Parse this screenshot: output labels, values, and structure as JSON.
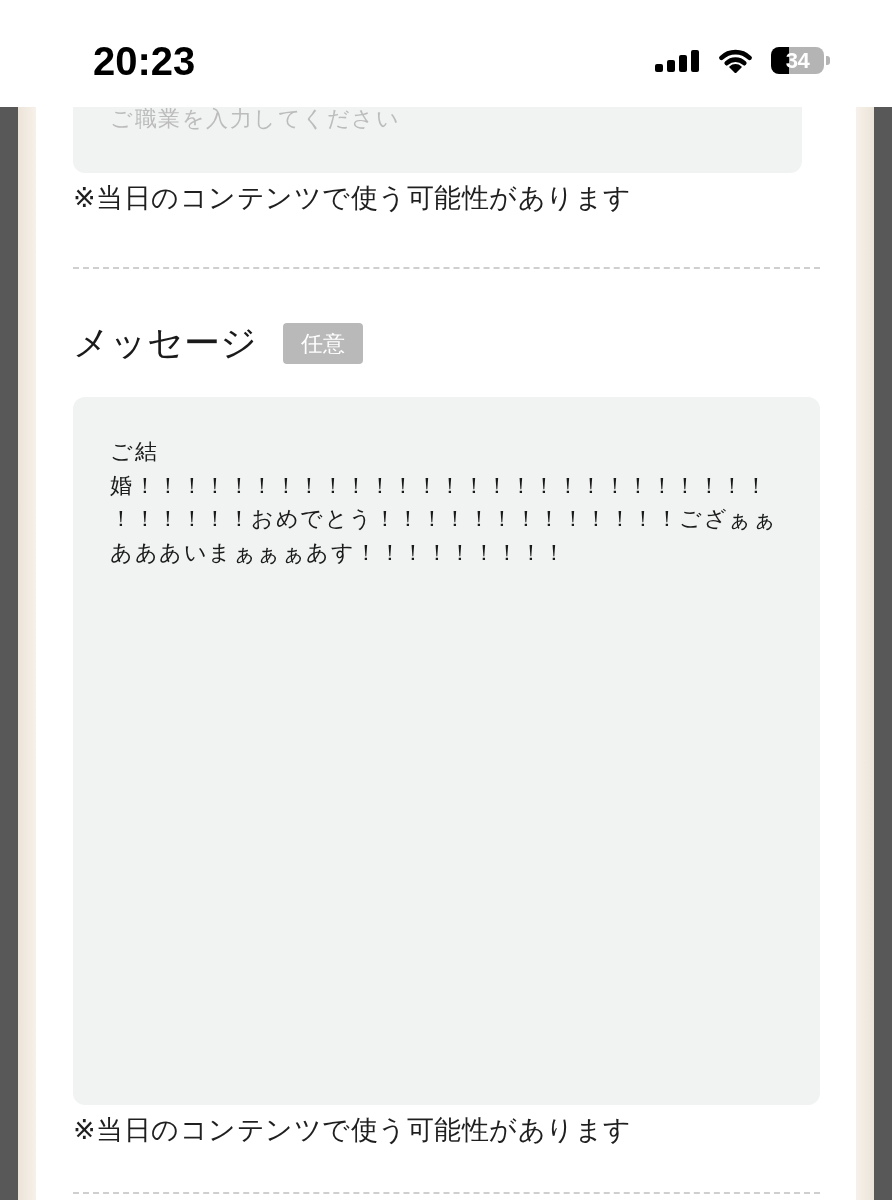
{
  "status_bar": {
    "time": "20:23",
    "battery": "34"
  },
  "occupation": {
    "placeholder": "ご職業を入力してください",
    "note": "※当日のコンテンツで使う可能性があります"
  },
  "message": {
    "label": "メッセージ",
    "badge": "任意",
    "value": "ご結婚！！！！！！！！！！！！！！！！！！！！！！！！！！！！！！！！！おめでとう！！！！！！！！！！！！！ござぁぁあああいまぁぁぁあす！！！！！！！！！",
    "note": "※当日のコンテンツで使う可能性があります"
  }
}
